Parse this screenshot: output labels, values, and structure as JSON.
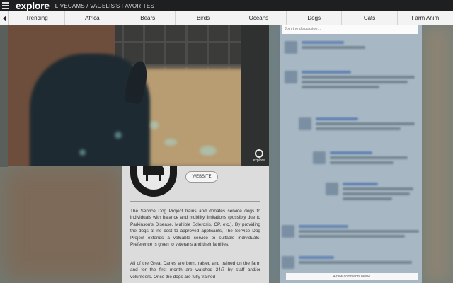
{
  "header": {
    "logo_text": "explore",
    "breadcrumb_section": "LIVECAMS",
    "breadcrumb_separator": "/",
    "breadcrumb_page": "VAGELIS'S FAVORITES"
  },
  "category_nav": {
    "items": [
      {
        "label": "Trending"
      },
      {
        "label": "Africa"
      },
      {
        "label": "Bears"
      },
      {
        "label": "Birds"
      },
      {
        "label": "Oceans"
      },
      {
        "label": "Dogs"
      },
      {
        "label": "Cats"
      },
      {
        "label": "Farm Anim"
      }
    ]
  },
  "video": {
    "watermark_text": "explore"
  },
  "info": {
    "website_button": "WEBSITE",
    "paragraph_1": "The Service Dog Project trains and donates service dogs to individuals with balance and mobility limitations (possibly due to Parkinson's Disease, Multiple Sclerosis, CP, etc.). By providing the dogs at no cost to approved applicants, The Service Dog Project extends a valuable service to suitable individuals. Preference is given to veterans and their families.",
    "paragraph_2": "All of the Great Danes are born, raised and trained on the farm and for the first month are watched 24/7 by staff and/or volunteers. Once the dogs are fully trained"
  },
  "comments": {
    "join_placeholder": "Join the discussion...",
    "new_comments": "4 new comments below"
  },
  "colors": {
    "header_bg": "#1d1f21",
    "nav_bg": "#f3f3f3",
    "comments_bg": "#a7b8c4"
  }
}
